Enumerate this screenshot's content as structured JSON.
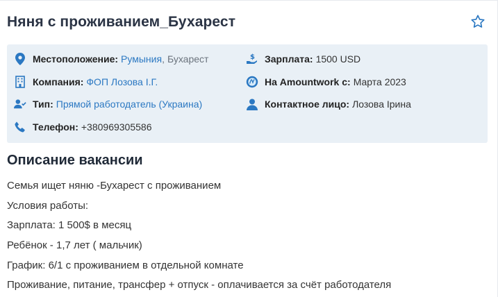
{
  "job": {
    "title": "Няня с проживанием_Бухарест"
  },
  "info": {
    "location_label": "Местоположение:",
    "location_country": "Румыния",
    "location_sep": ",",
    "location_city": "Бухарест",
    "salary_label": "Зарплата:",
    "salary_value": "1500 USD",
    "company_label": "Компания:",
    "company_value": "ФОП Лозова І.Г.",
    "since_label": "На Amountwork с:",
    "since_value": "Марта 2023",
    "type_label": "Тип:",
    "type_value": "Прямой работодатель (Украина)",
    "contact_label": "Контактное лицо:",
    "contact_value": "Лозова Ірина",
    "phone_label": "Телефон:",
    "phone_value": "+380969305586"
  },
  "description": {
    "heading": "Описание вакансии",
    "lines": [
      "Семья ищет няню -Бухарест с проживанием",
      "Условия работы:",
      "Зарплата: 1 500$ в месяц",
      "Ребёнок - 1,7 лет ( мальчик)",
      "График: 6/1 с проживанием в отдельной комнате",
      "Проживание, питание, трансфер + отпуск - оплачивается за счёт работодателя"
    ]
  },
  "icons": {
    "accent": "#2b78c2",
    "favorite": "star-outline-icon"
  }
}
